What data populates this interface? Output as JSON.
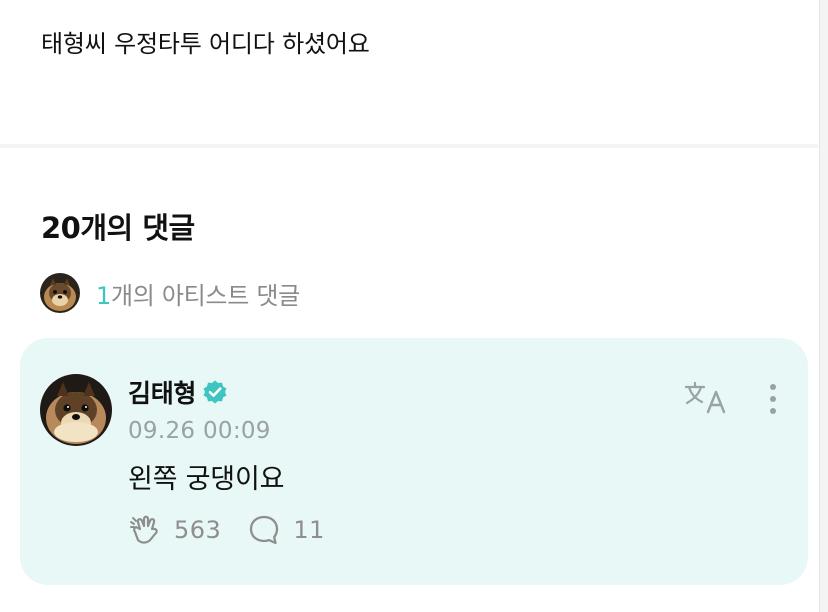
{
  "post": {
    "text": "태형씨 우정타투 어디다 하셨어요"
  },
  "comments_section": {
    "heading": "20개의 댓글",
    "artist_summary_count": "1",
    "artist_summary_label": "개의 아티스트 댓글"
  },
  "comment": {
    "author": "김태형",
    "timestamp": "09.26 00:09",
    "body": "왼쪽 궁댕이요",
    "like_count": "563",
    "reply_count": "11",
    "verified_icon": "verified-check-icon",
    "translate_icon": "translate-icon",
    "more_icon": "more-vertical-icon"
  },
  "colors": {
    "accent": "#3ec5c2",
    "card_background": "#e7f8f6",
    "muted_text": "#8e8e8e",
    "timestamp_text": "#9aa2a3"
  }
}
